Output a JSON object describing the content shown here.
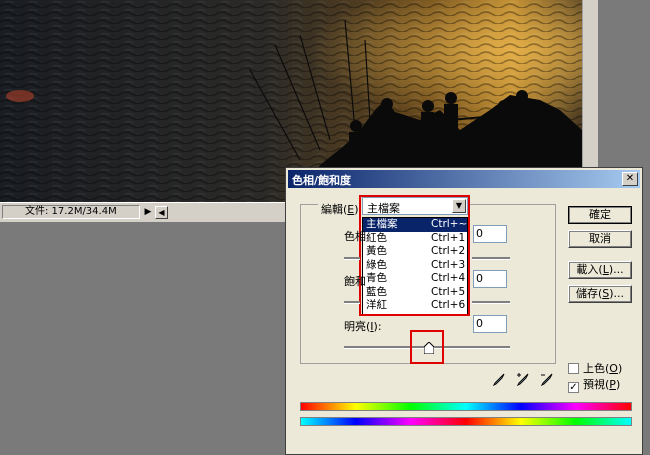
{
  "document": {
    "status_text": "文件: 17.2M/34.4M",
    "status_arrow": "▶",
    "scroll_left": "◀"
  },
  "dialog": {
    "title": "色相/飽和度",
    "close_label": "✕",
    "edit": {
      "label_prefix": "編輯(",
      "label_key": "E",
      "label_suffix": "):",
      "selected": "主檔案",
      "options": [
        {
          "label": "主檔案",
          "shortcut": "Ctrl+~"
        },
        {
          "label": "紅色",
          "shortcut": "Ctrl+1"
        },
        {
          "label": "黃色",
          "shortcut": "Ctrl+2"
        },
        {
          "label": "綠色",
          "shortcut": "Ctrl+3"
        },
        {
          "label": "青色",
          "shortcut": "Ctrl+4"
        },
        {
          "label": "藍色",
          "shortcut": "Ctrl+5"
        },
        {
          "label": "洋紅",
          "shortcut": "Ctrl+6"
        }
      ]
    },
    "hue": {
      "label": "色相",
      "value": "0"
    },
    "saturation": {
      "label": "飽和",
      "value": "0"
    },
    "lightness": {
      "label_prefix": "明亮(",
      "label_key": "I",
      "label_suffix": "):",
      "value": "0",
      "slider_fraction": 0.5
    },
    "buttons": {
      "ok": "確定",
      "cancel": "取消",
      "load_prefix": "載入(",
      "load_key": "L",
      "load_suffix": ")...",
      "save_prefix": "儲存(",
      "save_key": "S",
      "save_suffix": ")..."
    },
    "colorize": {
      "prefix": "上色(",
      "key": "O",
      "suffix": ")",
      "checked": false
    },
    "preview": {
      "prefix": "預視(",
      "key": "P",
      "suffix": ")",
      "checked": true
    },
    "check_mark": "✓",
    "colors": {
      "highlight": "#e00000",
      "title_bar": "#0a246a"
    }
  }
}
